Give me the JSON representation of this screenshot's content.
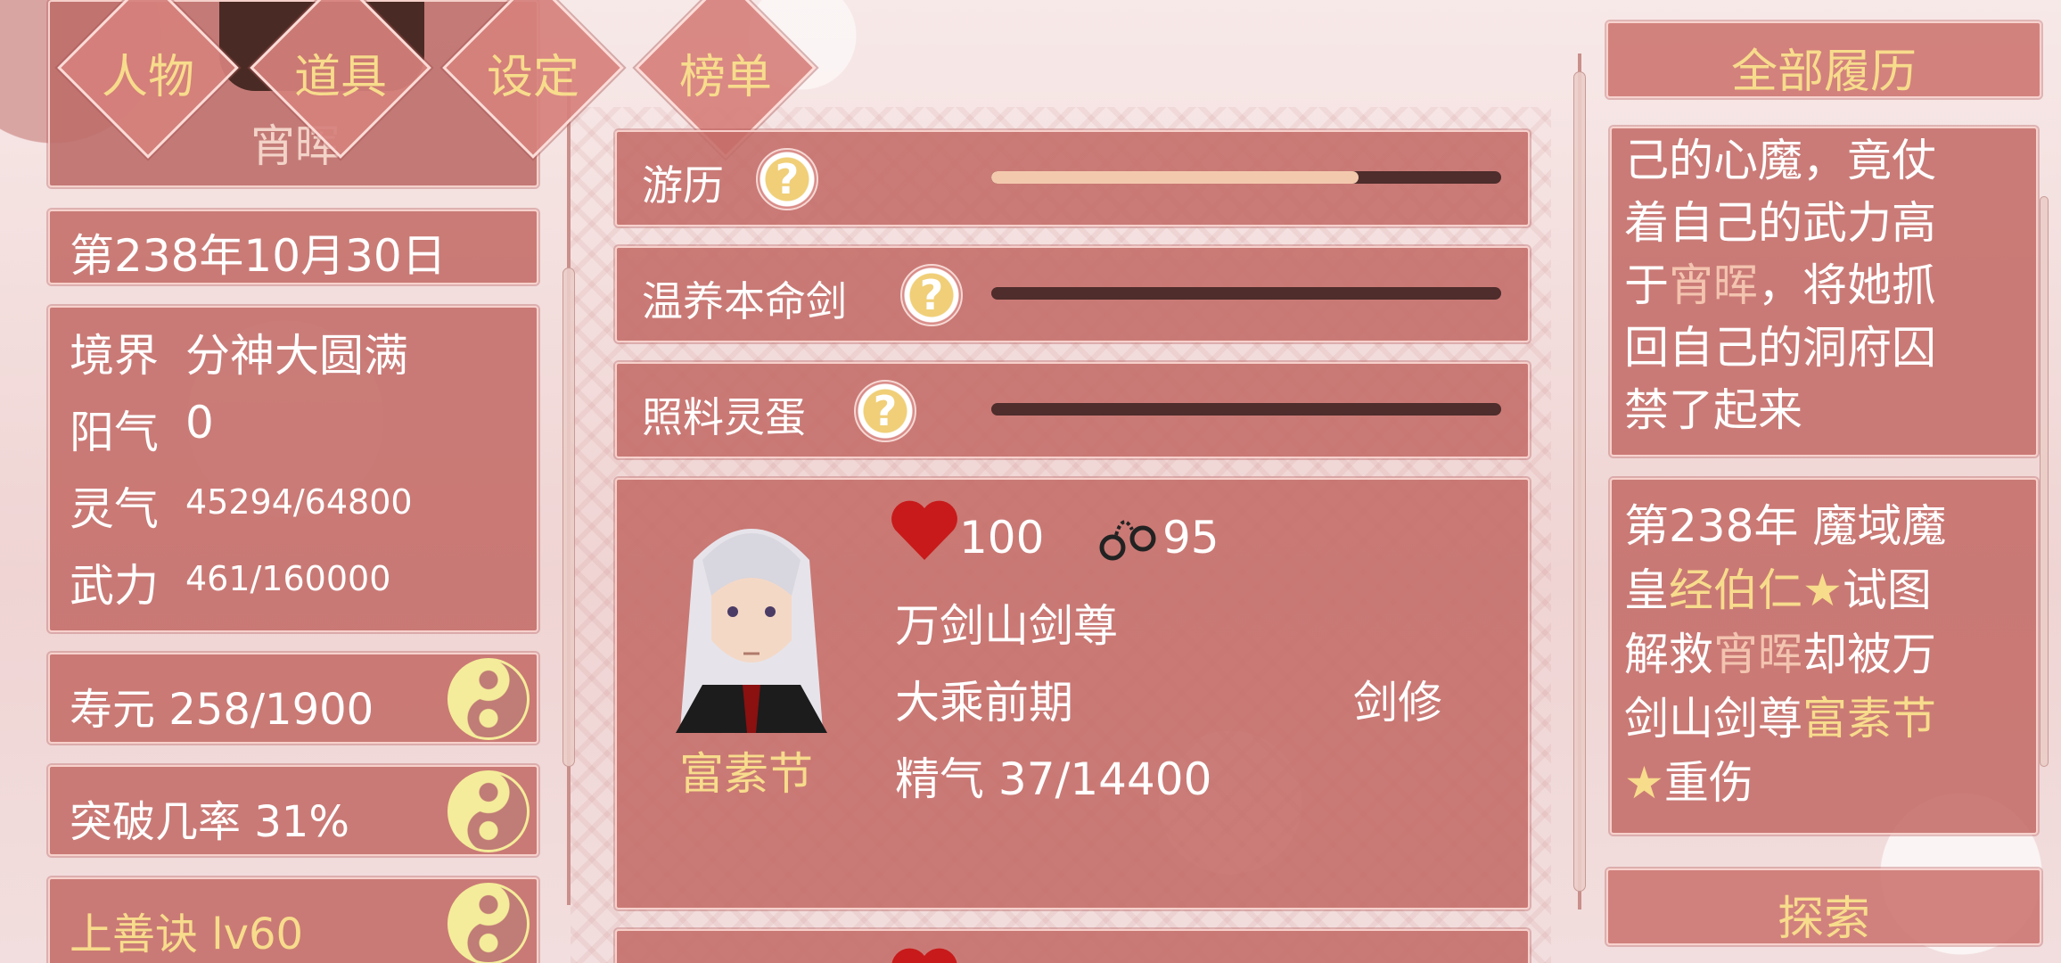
{
  "nav": {
    "tabs": [
      {
        "label": "人物"
      },
      {
        "label": "道具"
      },
      {
        "label": "设定"
      },
      {
        "label": "榜单"
      }
    ]
  },
  "player": {
    "name": "宵晖",
    "date": "第238年10月30日",
    "stats": {
      "realm_label": "境界",
      "realm_value": "分神大圆满",
      "yang_label": "阳气",
      "yang_value": "0",
      "qi_label": "灵气",
      "qi_value": "45294/64800",
      "force_label": "武力",
      "force_value": "461/160000"
    },
    "lifespan": "寿元 258/1900",
    "breakthrough": "突破几率 31%",
    "skill": "上善诀 lv60"
  },
  "activities": [
    {
      "label": "游历",
      "progress": 0.72
    },
    {
      "label": "温养本命剑",
      "progress": 0
    },
    {
      "label": "照料灵蛋",
      "progress": 0
    }
  ],
  "character_card": {
    "name": "富素节",
    "affection": "100",
    "restraint": "95",
    "title": "万剑山剑尊",
    "realm": "大乘前期",
    "profession": "剑修",
    "essence": "精气 37/14400"
  },
  "history": {
    "header": "全部履历",
    "entry1": {
      "line1": "己的心魔，竟仗",
      "line2": "着自己的武力高",
      "line3a": "于",
      "line3b": "宵晖",
      "line3c": "，将她抓",
      "line4": "回自己的洞府囚",
      "line5": "禁了起来"
    },
    "entry2": {
      "line1": "第238年 魔域魔",
      "line2a": "皇",
      "line2b": "经伯仁★",
      "line2c": "试图",
      "line3a": "解救",
      "line3b": "宵晖",
      "line3c": "却被万",
      "line4a": "剑山剑尊",
      "line4b": "富素节",
      "line5a": "★",
      "line5b": "重伤"
    },
    "explore": "探索"
  },
  "icons": {
    "question": "?",
    "heart": "heart-icon",
    "handcuffs": "handcuffs-icon",
    "yinyang": "yinyang-icon"
  },
  "colors": {
    "panel": "#c46c68",
    "accent_gold": "#f7dc8c",
    "bar_dark": "#4e2d2c",
    "bar_fill": "#f3c9ad"
  }
}
